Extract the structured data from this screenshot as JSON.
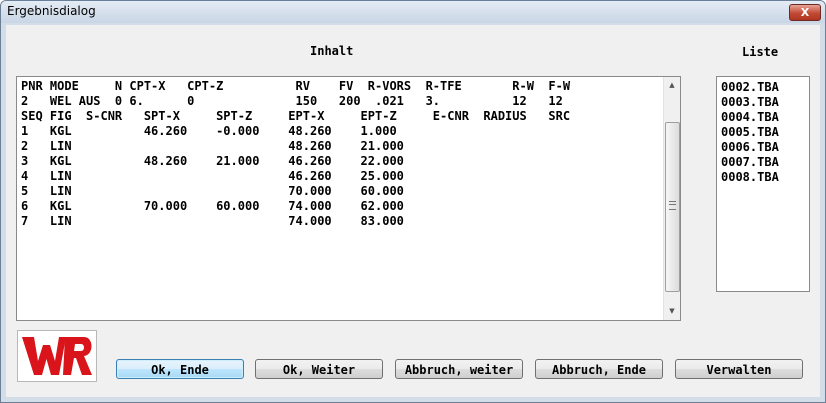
{
  "window": {
    "title": "Ergebnisdialog",
    "close_symbol": "X"
  },
  "inhalt": {
    "label": "Inhalt",
    "lines": [
      "PNR MODE     N CPT-X   CPT-Z          RV    FV  R-VORS  R-TFE       R-W  F-W",
      "2   WEL AUS  0 6.      0              150   200  .021   3.          12   12",
      "SEQ FIG  S-CNR   SPT-X     SPT-Z     EPT-X     EPT-Z     E-CNR  RADIUS   SRC",
      "1   KGL          46.260    -0.000    48.260    1.000",
      "2   LIN                              48.260    21.000",
      "3   KGL          48.260    21.000    46.260    22.000",
      "4   LIN                              46.260    25.000",
      "5   LIN                              70.000    60.000",
      "6   KGL          70.000    60.000    74.000    62.000",
      "7   LIN                              74.000    83.000"
    ]
  },
  "liste": {
    "label": "Liste",
    "items": [
      "0002.TBA",
      "0003.TBA",
      "0004.TBA",
      "0005.TBA",
      "0006.TBA",
      "0007.TBA",
      "0008.TBA"
    ]
  },
  "logo": {
    "text": "WR",
    "color": "#d9141b"
  },
  "buttons": {
    "ok_ende": "Ok, Ende",
    "ok_weiter": "Ok, Weiter",
    "abbruch_weiter": "Abbruch, weiter",
    "abbruch_ende": "Abbruch, Ende",
    "verwalten": "Verwalten"
  }
}
